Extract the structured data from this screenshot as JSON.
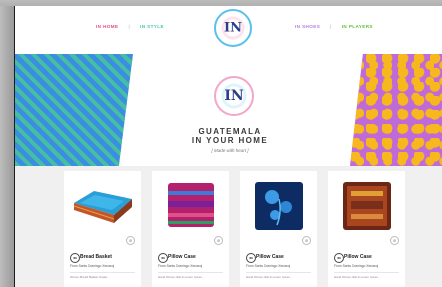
{
  "nav": {
    "left": [
      "IN HOME",
      "IN STYLE"
    ],
    "right": [
      "IN SHOES",
      "IN PLAYERS"
    ],
    "separator": "|"
  },
  "logo": {
    "text": "IN"
  },
  "banner": {
    "title_line1": "GUATEMALA",
    "title_line2": "IN YOUR HOME",
    "subtitle": "[ Made with heart ]"
  },
  "products": [
    {
      "name": "Bread Basket",
      "origin": "From Santo Domingo Xenacoj",
      "desc": "Woven Bread Basket Guate..."
    },
    {
      "name": "Pillow Case",
      "origin": "From Santo Domingo Xenacoj",
      "desc": "Hand Woven Ikat & Lorem Ipsum..."
    },
    {
      "name": "Pillow Case",
      "origin": "From Santo Domingo Xenacoj",
      "desc": "Hand Woven Ikat & Lorem Ipsum..."
    },
    {
      "name": "Pillow Case",
      "origin": "From Santo Domingo Xenacoj",
      "desc": "Hand Woven Ikat & Lorem Ipsum..."
    }
  ],
  "colors": {
    "home": "#e94b7c",
    "style": "#47c3ad",
    "shoes": "#b17be0",
    "players": "#5fbf3b"
  }
}
